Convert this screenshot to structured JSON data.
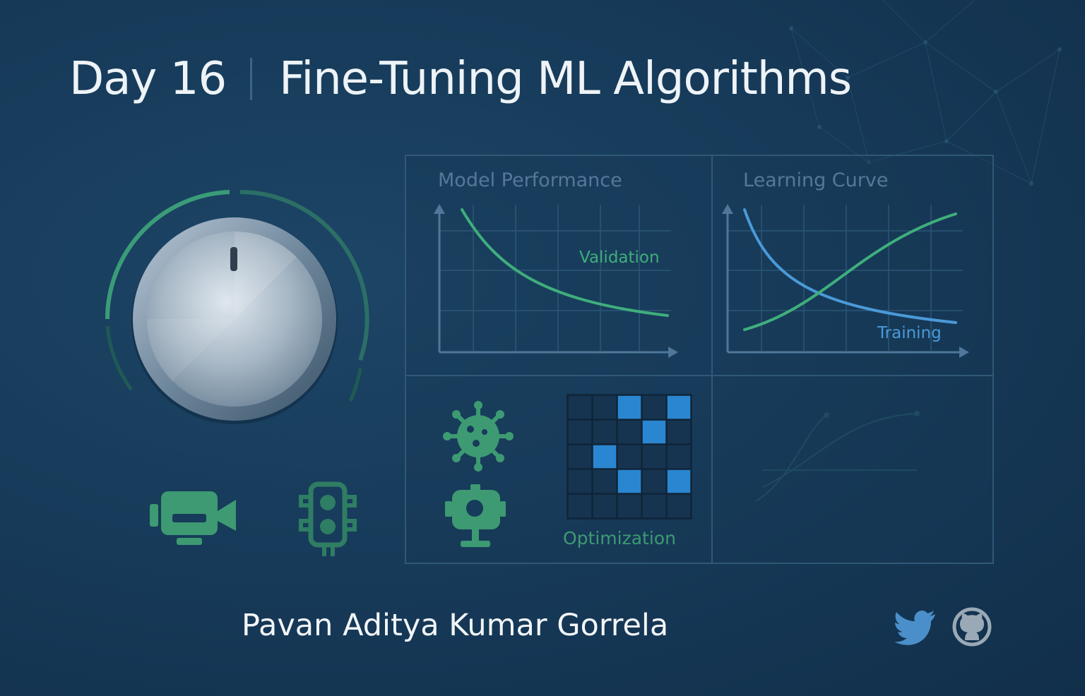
{
  "header": {
    "day": "Day 16",
    "title": "Fine-Tuning ML Algorithms"
  },
  "panels": {
    "model_performance": {
      "label": "Model Performance",
      "curve_label": "Validation"
    },
    "learning_curve": {
      "label": "Learning Curve",
      "curve_label": "Training"
    },
    "optimization": {
      "label": "Optimization"
    }
  },
  "footer": {
    "author": "Pavan Aditya Kumar Gorrela",
    "social_icons": [
      "twitter-icon",
      "github-icon"
    ]
  },
  "icons": [
    "dial-knob",
    "video-camera-icon",
    "traffic-light-icon",
    "virus-icon",
    "webcam-icon",
    "grid-matrix"
  ],
  "colors": {
    "background": "#173b5a",
    "accent_green": "#3fa67a",
    "accent_blue": "#4a9ad8",
    "grid_cell_blue": "#2a86d0",
    "text_light": "#eef3f7"
  }
}
